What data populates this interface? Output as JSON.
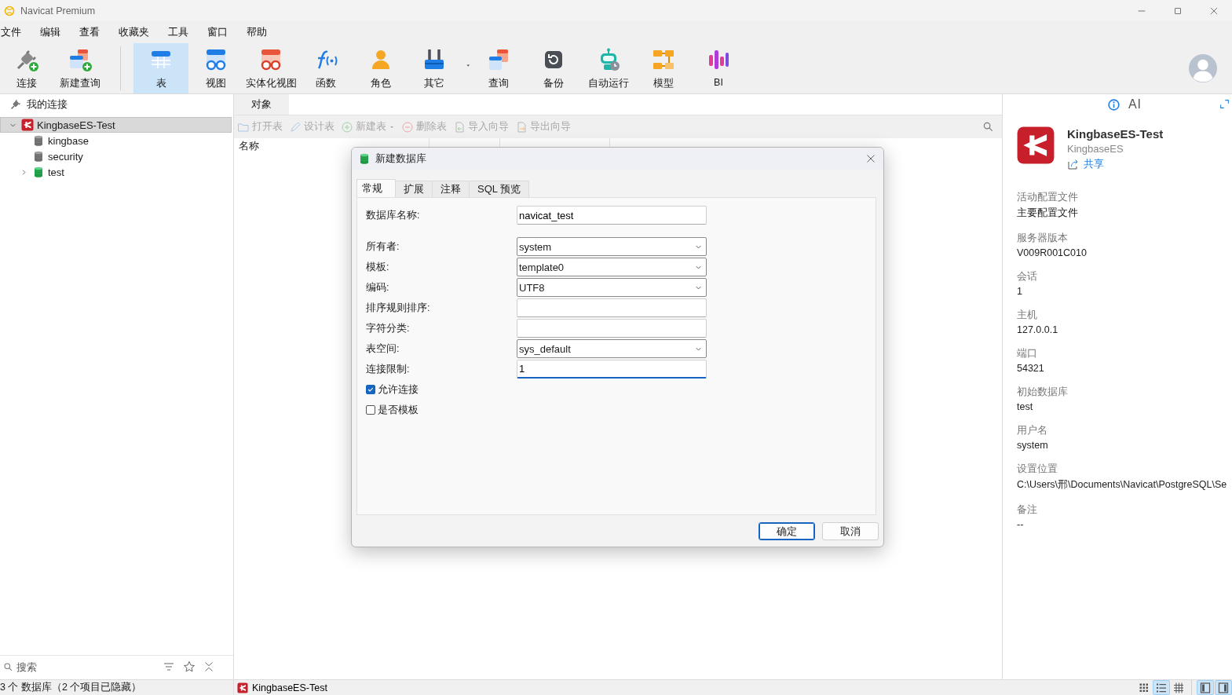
{
  "window": {
    "title": "Navicat Premium"
  },
  "menu": [
    "文件",
    "编辑",
    "查看",
    "收藏夹",
    "工具",
    "窗口",
    "帮助"
  ],
  "toolbar": {
    "groups": [
      [
        {
          "label": "连接",
          "kind": "connect",
          "selected": false
        },
        {
          "label": "新建查询",
          "kind": "new_query",
          "selected": false
        }
      ],
      [
        {
          "label": "表",
          "kind": "table",
          "selected": true
        },
        {
          "label": "视图",
          "kind": "view",
          "selected": false
        },
        {
          "label": "实体化视图",
          "kind": "materialized_view",
          "selected": false
        },
        {
          "label": "函数",
          "kind": "function",
          "selected": false
        },
        {
          "label": "角色",
          "kind": "role",
          "selected": false
        },
        {
          "label": "其它",
          "kind": "other",
          "selected": false,
          "dropdown": true
        },
        {
          "label": "查询",
          "kind": "query",
          "selected": false
        },
        {
          "label": "备份",
          "kind": "backup",
          "selected": false
        },
        {
          "label": "自动运行",
          "kind": "automation",
          "selected": false
        },
        {
          "label": "模型",
          "kind": "model",
          "selected": false
        },
        {
          "label": "BI",
          "kind": "bi",
          "selected": false
        }
      ]
    ]
  },
  "sidebar": {
    "header": "我的连接",
    "tree": [
      {
        "label": "KingbaseES-Test",
        "kind": "server",
        "selected": true,
        "expanded": true,
        "children": [
          {
            "label": "kingbase",
            "kind": "database",
            "selected": false,
            "open": false
          },
          {
            "label": "security",
            "kind": "database",
            "selected": false,
            "open": false
          },
          {
            "label": "test",
            "kind": "database",
            "selected": false,
            "open": true,
            "expanded": false
          }
        ]
      }
    ],
    "search": {
      "placeholder": "搜索"
    }
  },
  "objects": {
    "tabs": [
      {
        "label": "对象",
        "selected": true
      }
    ],
    "actions": [
      {
        "label": "打开表",
        "kind": "open",
        "disabled": true
      },
      {
        "label": "设计表",
        "kind": "design",
        "disabled": true
      },
      {
        "label": "新建表",
        "kind": "new",
        "disabled": true,
        "dropdown": true
      },
      {
        "label": "删除表",
        "kind": "delete",
        "disabled": true
      },
      {
        "label": "导入向导",
        "kind": "import",
        "disabled": true
      },
      {
        "label": "导出向导",
        "kind": "export",
        "disabled": true
      }
    ],
    "columns": [
      "名称"
    ]
  },
  "info": {
    "tabs": [
      {
        "kind": "icon",
        "selected": true
      },
      {
        "kind": "text",
        "label": "AI",
        "selected": false
      }
    ],
    "connection": {
      "name": "KingbaseES-Test",
      "type": "KingbaseES",
      "share": "共享"
    },
    "properties": [
      {
        "label": "活动配置文件",
        "value": "主要配置文件"
      },
      {
        "label": "服务器版本",
        "value": "V009R001C010"
      },
      {
        "label": "会话",
        "value": "1"
      },
      {
        "label": "主机",
        "value": "127.0.0.1"
      },
      {
        "label": "端口",
        "value": "54321"
      },
      {
        "label": "初始数据库",
        "value": "test"
      },
      {
        "label": "用户名",
        "value": "system"
      },
      {
        "label": "设置位置",
        "value": "C:\\Users\\邢\\Documents\\Navicat\\PostgreSQL\\Se"
      },
      {
        "label": "备注",
        "value": "--"
      }
    ]
  },
  "status_bar": {
    "text": "3 个 数据库（2 个项目已隐藏）",
    "tab": "KingbaseES-Test",
    "views": [
      {
        "kind": "icons",
        "selected": false
      },
      {
        "kind": "list",
        "selected": true
      },
      {
        "kind": "details",
        "selected": false
      }
    ],
    "panels": [
      {
        "kind": "left",
        "selected": true
      },
      {
        "kind": "right",
        "selected": true
      }
    ]
  },
  "dialog": {
    "title": "新建数据库",
    "tabs": [
      {
        "label": "常规",
        "selected": true
      },
      {
        "label": "扩展",
        "selected": false
      },
      {
        "label": "注释",
        "selected": false
      },
      {
        "label": "SQL 预览",
        "selected": false
      }
    ],
    "name_field": {
      "label": "数据库名称:",
      "value": "navicat_test",
      "focused": false
    },
    "fields": [
      {
        "label": "所有者:",
        "kind": "select",
        "value": "system",
        "focused": false
      },
      {
        "label": "模板:",
        "kind": "select",
        "value": "template0",
        "focused": false
      },
      {
        "label": "编码:",
        "kind": "select",
        "value": "UTF8",
        "focused": false
      },
      {
        "label": "排序规则排序:",
        "kind": "text",
        "focused": false
      },
      {
        "label": "字符分类:",
        "kind": "text",
        "focused": false
      },
      {
        "label": "表空间:",
        "kind": "select",
        "value": "sys_default",
        "focused": false
      },
      {
        "label": "连接限制:",
        "kind": "text",
        "value": "1",
        "focused": true
      }
    ],
    "checkboxes": [
      {
        "label": "允许连接",
        "checked": true
      },
      {
        "label": "是否模板",
        "checked": false
      }
    ],
    "buttons": [
      {
        "label": "确定",
        "default": true
      },
      {
        "label": "取消",
        "default": false
      }
    ]
  }
}
